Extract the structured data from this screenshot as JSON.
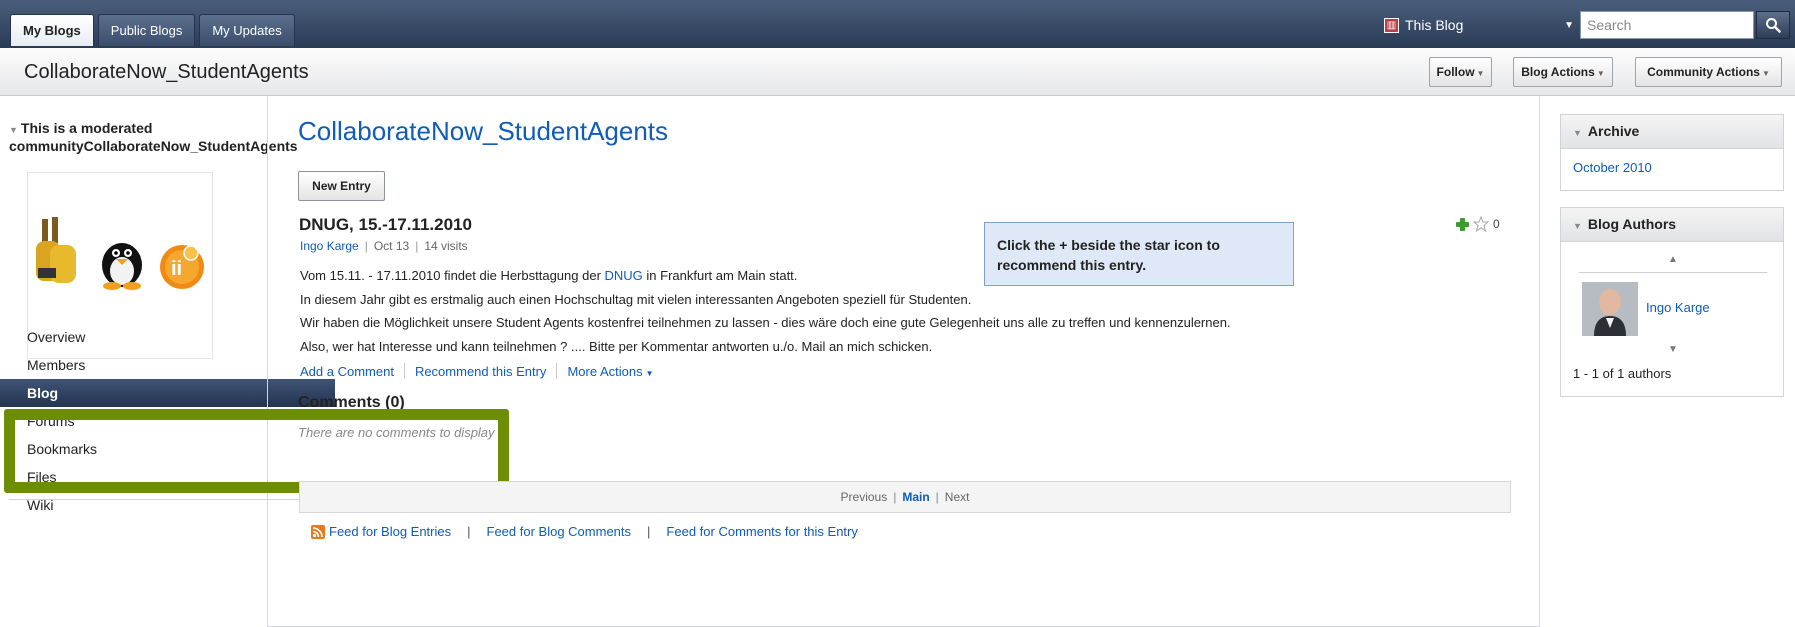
{
  "tabs": [
    {
      "label": "My Blogs",
      "active": true
    },
    {
      "label": "Public Blogs",
      "active": false
    },
    {
      "label": "My Updates",
      "active": false
    }
  ],
  "scope": {
    "label": "This Blog",
    "icon": "blog-book-icon"
  },
  "search": {
    "placeholder": "Search"
  },
  "header": {
    "community_title": "CollaborateNow_StudentAgents",
    "follow_label": "Follow",
    "blog_actions_label": "Blog Actions",
    "community_actions_label": "Community Actions"
  },
  "sidebar": {
    "moderated_line1": "This is a moderated",
    "moderated_line2": "communityCollaborateNow_StudentAgents",
    "items": [
      {
        "label": "Overview",
        "active": false
      },
      {
        "label": "Members",
        "active": false
      },
      {
        "label": "Blog",
        "active": true
      },
      {
        "label": "Forums",
        "active": false
      },
      {
        "label": "Bookmarks",
        "active": false
      },
      {
        "label": "Files",
        "active": false
      },
      {
        "label": "Wiki",
        "active": false
      }
    ]
  },
  "main": {
    "blog_title": "CollaborateNow_StudentAgents",
    "new_entry_label": "New Entry",
    "entry": {
      "title": "DNUG, 15.-17.11.2010",
      "author": "Ingo Karge",
      "date": "Oct 13",
      "visits": "14 visits",
      "body_line1_pre": "Vom 15.11. - 17.11.2010 findet die Herbsttagung der ",
      "body_line1_link": "DNUG",
      "body_line1_post": " in Frankfurt am Main statt.",
      "body_line2": "In diesem Jahr gibt es erstmalig auch einen Hochschultag mit vielen interessanten Angeboten speziell für Studenten.",
      "body_line3": "Wir haben die Möglichkeit unsere Student Agents kostenfrei teilnehmen zu lassen - dies wäre doch eine gute Gelegenheit uns alle zu treffen und kennenzulernen.",
      "body_line4": "Also, wer hat Interesse und kann teilnehmen ? .... Bitte per Kommentar antworten u./o. Mail an mich schicken.",
      "recommend_count": "0"
    },
    "actions": {
      "add_comment": "Add a Comment",
      "recommend": "Recommend this Entry",
      "more_actions": "More Actions"
    },
    "tooltip": "Click the + beside the star icon to recommend this entry.",
    "comments_heading": "Comments (0)",
    "no_comments": "There are no comments to display",
    "pager": {
      "previous": "Previous",
      "main": "Main",
      "next": "Next"
    },
    "feeds": {
      "blog_entries": "Feed for Blog Entries",
      "blog_comments": "Feed for Blog Comments",
      "entry_comments": "Feed for Comments for this Entry"
    }
  },
  "right": {
    "archive_title": "Archive",
    "archive_link": "October 2010",
    "authors_title": "Blog Authors",
    "author_name": "Ingo Karge",
    "author_count": "1 - 1 of 1 authors"
  },
  "colors": {
    "link": "#105cb6",
    "highlight": "#6e8d07",
    "topbar": "#2a3b55"
  }
}
